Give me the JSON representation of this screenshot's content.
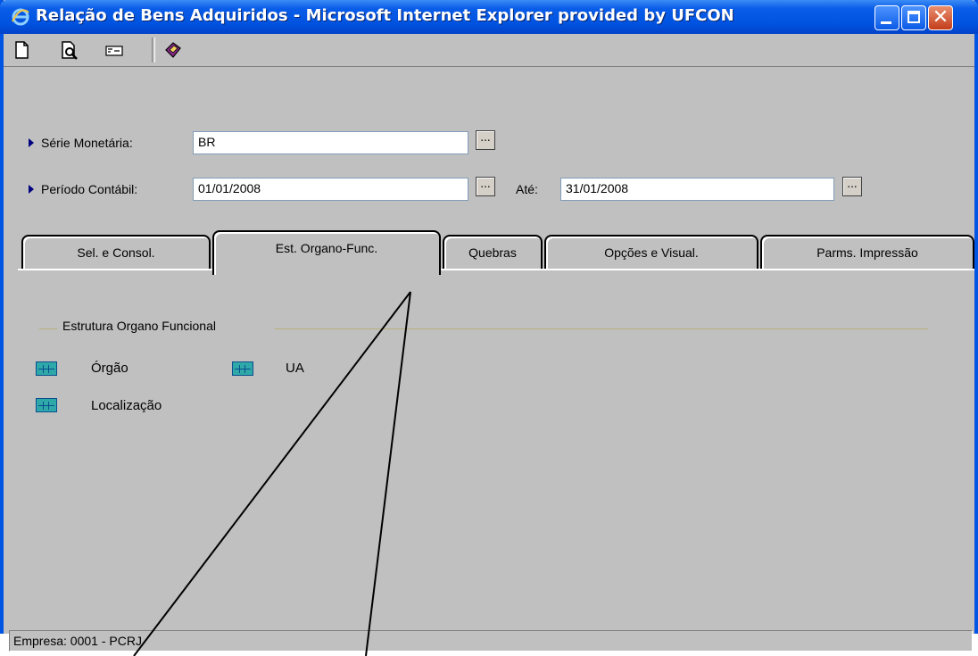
{
  "window": {
    "title": "Relação de Bens Adquiridos - Microsoft Internet Explorer provided by UFCON",
    "minimize_icon": "minimize-icon",
    "maximize_icon": "maximize-icon",
    "close_icon": "close-icon",
    "close_glyph": "✕"
  },
  "toolbar": {
    "buttons": [
      "new-document-icon",
      "print-preview-icon",
      "export-icon",
      "help-book-icon"
    ]
  },
  "form": {
    "serie_label": "Série Monetária:",
    "serie_value": "BR",
    "periodo_label": "Período Contábil:",
    "periodo_from": "01/01/2008",
    "ate_label": "Até:",
    "periodo_to": "31/01/2008",
    "ellipsis": "..."
  },
  "tabs": [
    {
      "label": "Sel. e Consol."
    },
    {
      "label": "Est. Organo-Func."
    },
    {
      "label": "Quebras"
    },
    {
      "label": "Opções e Visual."
    },
    {
      "label": "Parms. Impressão"
    }
  ],
  "active_tab": "Est. Organo-Func.",
  "group": {
    "title": "Estrutura Organo Funcional",
    "items": [
      {
        "label": "Órgão"
      },
      {
        "label": "UA"
      },
      {
        "label": "Localização"
      }
    ]
  },
  "status": {
    "text": "Empresa: 0001 - PCRJ"
  },
  "colors": {
    "titlebar": "#0053e0",
    "window_bg": "#c0c0c0",
    "grid_icon": "#2ea8a8"
  }
}
